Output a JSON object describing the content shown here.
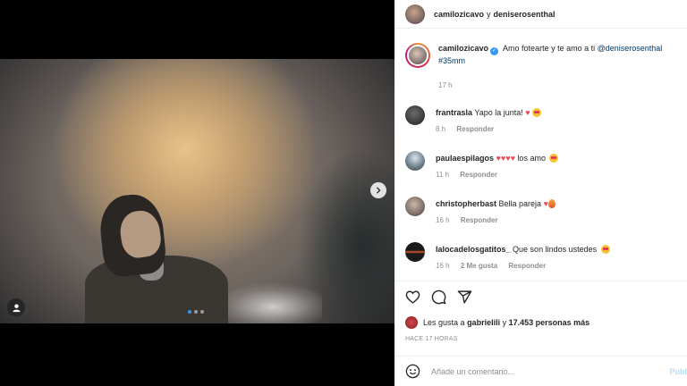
{
  "post": {
    "header": {
      "user1": "camilozicavo",
      "sep": "y",
      "user2": "deniserosenthal"
    },
    "caption": {
      "username": "camilozicavo",
      "text": "Amo fotearte y te amo a ti",
      "mention": "@deniserosenthal",
      "hashtag": "#35mm",
      "time": "17 h"
    },
    "comments": [
      {
        "username": "frantrasla",
        "text": "Yapo la junta!",
        "emojis": [
          "heart-emoji",
          "star-struck-emoji"
        ],
        "time": "8 h",
        "reply": "Responder"
      },
      {
        "username": "paulaespilagos",
        "text": "los amo",
        "emojis": [
          "heart-emoji",
          "heart-emoji",
          "heart-emoji",
          "heart-emoji",
          "star-struck-emoji"
        ],
        "time": "11 h",
        "reply": "Responder"
      },
      {
        "username": "christopherbast",
        "text": "Bella pareja",
        "emojis": [
          "heart-emoji",
          "fire-emoji"
        ],
        "time": "16 h",
        "reply": "Responder"
      },
      {
        "username": "lalocadelosgatitos_",
        "text": "Que son lindos ustedes",
        "emojis": [
          "star-struck-emoji"
        ],
        "time": "16 h",
        "likes": "2 Me gusta",
        "reply": "Responder"
      }
    ],
    "likes": {
      "prefix": "Les gusta a",
      "user": "gabrielili",
      "middle": "y",
      "count": "17.453 personas más"
    },
    "timestamp": "HACE 17 HORAS",
    "add_comment": {
      "placeholder": "Añade un comentario...",
      "publish": "Publ"
    },
    "carousel": {
      "total": 3,
      "active": 1
    }
  },
  "colors": {
    "link": "#00376b",
    "verified": "#3897f0",
    "heart": "#ed4956",
    "muted": "#8e8e8e",
    "publish": "#b2dffc"
  },
  "icons": [
    "tag-user-icon",
    "next-arrow-icon",
    "like-icon",
    "comment-icon",
    "share-icon",
    "emoji-icon",
    "verified-badge-icon"
  ]
}
